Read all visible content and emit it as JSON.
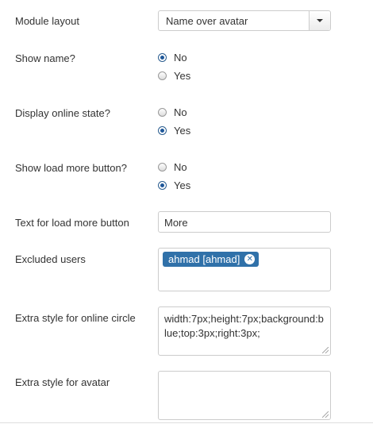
{
  "fields": {
    "module_layout": {
      "label": "Module layout",
      "value": "Name over avatar"
    },
    "show_name": {
      "label": "Show name?",
      "options": [
        "No",
        "Yes"
      ],
      "selected": "No"
    },
    "display_online_state": {
      "label": "Display online state?",
      "options": [
        "No",
        "Yes"
      ],
      "selected": "Yes"
    },
    "show_load_more": {
      "label": "Show load more button?",
      "options": [
        "No",
        "Yes"
      ],
      "selected": "Yes"
    },
    "load_more_text": {
      "label": "Text for load more button",
      "value": "More"
    },
    "excluded_users": {
      "label": "Excluded users",
      "tags": [
        "ahmad [ahmad]"
      ]
    },
    "online_circle_style": {
      "label": "Extra style for online circle",
      "value": "width:7px;height:7px;background:blue;top:3px;right:3px;"
    },
    "avatar_style": {
      "label": "Extra style for avatar",
      "value": ""
    }
  },
  "icons": {
    "select_arrow": "caret-down-icon",
    "tag_remove": "remove-circle-icon",
    "resize": "resize-grip-icon"
  },
  "colors": {
    "tag_bg": "#3071a9",
    "radio_checked": "#1e5799",
    "border": "#cccccc",
    "text": "#333333"
  }
}
